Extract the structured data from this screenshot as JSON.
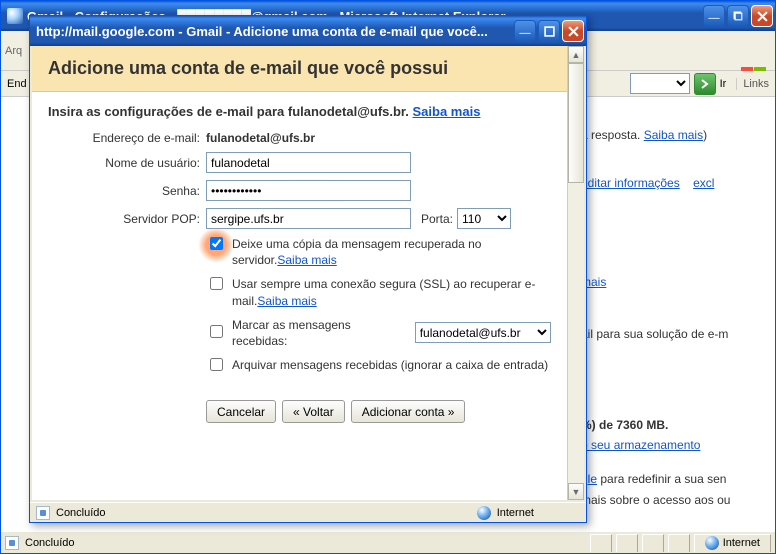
{
  "ie": {
    "title": "Gmail - Configurações - ████████@gmail.com - Microsoft Internet Explorer",
    "menu_fragment": "Arq",
    "addr_label": "End",
    "go_label": "Ir",
    "links_label": "Links",
    "status_done": "Concluído",
    "status_zone": "Internet"
  },
  "bg": {
    "line1_prefix": "a resposta. ",
    "line1_link": "Saiba mais",
    "line2a": "editar informações",
    "line2b": "excl",
    "line3": "mais",
    "line4": "ail para sua solução de e-m",
    "line5a": "%) de 7360 MB.",
    "line5b": "o seu armazenamento",
    "line6a": "gle",
    "line6b": " para redefinir a sua sen",
    "line6c": "mais sobre o acesso aos ou"
  },
  "popup": {
    "title": "http://mail.google.com - Gmail - Adicione uma conta de e-mail que você...",
    "heading": "Adicione uma conta de e-mail que você possui",
    "instruct_pre": "Insira as configurações de e-mail para fulanodetal@ufs.br. ",
    "instruct_link": "Saiba mais",
    "labels": {
      "email_addr": "Endereço de e-mail:",
      "username": "Nome de usuário:",
      "password": "Senha:",
      "pop": "Servidor POP:",
      "port": "Porta:"
    },
    "values": {
      "email_addr": "fulanodetal@ufs.br",
      "username": "fulanodetal",
      "password": "●●●●●●●●●●●●",
      "pop": "sergipe.ufs.br",
      "port": "110",
      "label_as": "fulanodetal@ufs.br"
    },
    "checks": {
      "leave_copy": "Deixe uma cópia da mensagem recuperada no servidor.",
      "ssl": "Usar sempre uma conexão segura (SSL) ao recuperar e-mail.",
      "label_msgs": "Marcar as mensagens recebidas:",
      "archive": "Arquivar mensagens recebidas (ignorar a caixa de entrada)",
      "learn_more": "Saiba mais"
    },
    "buttons": {
      "cancel": "Cancelar",
      "back": "« Voltar",
      "add": "Adicionar conta »"
    },
    "status_done": "Concluído",
    "status_zone": "Internet"
  }
}
